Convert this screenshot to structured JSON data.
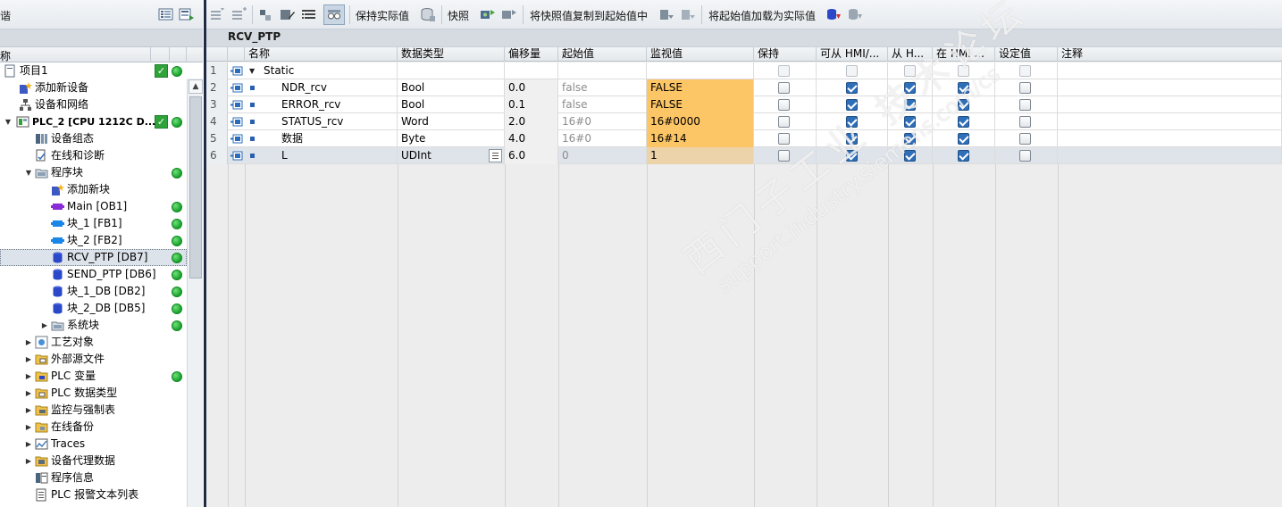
{
  "left_panel": {
    "toolbar_truncated_label": "谐",
    "column_header": "称",
    "tree": [
      {
        "label": "项目1",
        "indent": 0,
        "expand": "",
        "icon": "project-icon",
        "ok": true,
        "dot": true
      },
      {
        "label": "添加新设备",
        "indent": 1,
        "expand": "",
        "icon": "add-device-icon",
        "ok": false,
        "dot": false
      },
      {
        "label": "设备和网络",
        "indent": 1,
        "expand": "",
        "icon": "network-icon",
        "ok": false,
        "dot": false
      },
      {
        "label": "PLC_2 [CPU 1212C D...",
        "indent": 0,
        "expand": "down",
        "icon": "plc-icon",
        "ok": true,
        "dot": true,
        "bold": true
      },
      {
        "label": "设备组态",
        "indent": 2,
        "expand": "",
        "icon": "device-config-icon",
        "ok": false,
        "dot": false
      },
      {
        "label": "在线和诊断",
        "indent": 2,
        "expand": "",
        "icon": "online-diag-icon",
        "ok": false,
        "dot": false
      },
      {
        "label": "程序块",
        "indent": 2,
        "expand": "down",
        "icon": "folder-icon",
        "ok": false,
        "dot": true,
        "menu": "≡"
      },
      {
        "label": "添加新块",
        "indent": 3,
        "expand": "",
        "icon": "add-block-icon",
        "ok": false,
        "dot": false
      },
      {
        "label": "Main [OB1]",
        "indent": 3,
        "expand": "",
        "icon": "ob-icon",
        "ok": false,
        "dot": true
      },
      {
        "label": "块_1 [FB1]",
        "indent": 3,
        "expand": "",
        "icon": "fb-icon",
        "ok": false,
        "dot": true
      },
      {
        "label": "块_2 [FB2]",
        "indent": 3,
        "expand": "",
        "icon": "fb-icon",
        "ok": false,
        "dot": true
      },
      {
        "label": "RCV_PTP [DB7]",
        "indent": 3,
        "expand": "",
        "icon": "db-icon",
        "ok": false,
        "dot": true,
        "selected": true
      },
      {
        "label": "SEND_PTP [DB6]",
        "indent": 3,
        "expand": "",
        "icon": "db-icon",
        "ok": false,
        "dot": true
      },
      {
        "label": "块_1_DB [DB2]",
        "indent": 3,
        "expand": "",
        "icon": "db-icon",
        "ok": false,
        "dot": true
      },
      {
        "label": "块_2_DB [DB5]",
        "indent": 3,
        "expand": "",
        "icon": "db-icon",
        "ok": false,
        "dot": true
      },
      {
        "label": "系统块",
        "indent": 3,
        "expand": "right",
        "icon": "folder-icon",
        "ok": false,
        "dot": true
      },
      {
        "label": "工艺对象",
        "indent": 2,
        "expand": "right",
        "icon": "tech-object-icon",
        "ok": false,
        "dot": false
      },
      {
        "label": "外部源文件",
        "indent": 2,
        "expand": "right",
        "icon": "source-file-icon",
        "ok": false,
        "dot": false
      },
      {
        "label": "PLC 变量",
        "indent": 2,
        "expand": "right",
        "icon": "plc-tags-icon",
        "ok": false,
        "dot": true
      },
      {
        "label": "PLC 数据类型",
        "indent": 2,
        "expand": "right",
        "icon": "plc-datatype-icon",
        "ok": false,
        "dot": false
      },
      {
        "label": "监控与强制表",
        "indent": 2,
        "expand": "right",
        "icon": "watch-table-icon",
        "ok": false,
        "dot": false
      },
      {
        "label": "在线备份",
        "indent": 2,
        "expand": "right",
        "icon": "online-backup-icon",
        "ok": false,
        "dot": false
      },
      {
        "label": "Traces",
        "indent": 2,
        "expand": "right",
        "icon": "traces-icon",
        "ok": false,
        "dot": false
      },
      {
        "label": "设备代理数据",
        "indent": 2,
        "expand": "right",
        "icon": "proxy-data-icon",
        "ok": false,
        "dot": false
      },
      {
        "label": "程序信息",
        "indent": 2,
        "expand": "",
        "icon": "program-info-icon",
        "ok": false,
        "dot": false
      },
      {
        "label": "PLC 报警文本列表",
        "indent": 2,
        "expand": "",
        "icon": "alarm-text-icon",
        "ok": false,
        "dot": false
      }
    ]
  },
  "toolbar": {
    "keep_actual_label": "保持实际值",
    "snapshot_label": "快照",
    "copy_snapshot_label": "将快照值复制到起始值中",
    "load_start_label": "将起始值加载为实际值"
  },
  "editor": {
    "title": "RCV_PTP",
    "columns": {
      "name": "名称",
      "datatype": "数据类型",
      "offset": "偏移量",
      "start": "起始值",
      "monitor": "监视值",
      "retain": "保持",
      "hmi_access": "可从 HMI/...",
      "hmi_write": "从 H...",
      "hmi_visible": "在 HMI ...",
      "setpoint": "设定值",
      "comment": "注释"
    },
    "rows": [
      {
        "num": "1",
        "name": "Static",
        "type": "",
        "offset": "",
        "start": "",
        "monitor": "",
        "retain": false,
        "hmi_access": false,
        "hmi_write": false,
        "hmi_visible": false,
        "setpoint": false,
        "header": true
      },
      {
        "num": "2",
        "name": "NDR_rcv",
        "type": "Bool",
        "offset": "0.0",
        "start": "false",
        "monitor": "FALSE",
        "retain": false,
        "hmi_access": true,
        "hmi_write": true,
        "hmi_visible": true,
        "setpoint": false
      },
      {
        "num": "3",
        "name": "ERROR_rcv",
        "type": "Bool",
        "offset": "0.1",
        "start": "false",
        "monitor": "FALSE",
        "retain": false,
        "hmi_access": true,
        "hmi_write": true,
        "hmi_visible": true,
        "setpoint": false
      },
      {
        "num": "4",
        "name": "STATUS_rcv",
        "type": "Word",
        "offset": "2.0",
        "start": "16#0",
        "monitor": "16#0000",
        "retain": false,
        "hmi_access": true,
        "hmi_write": true,
        "hmi_visible": true,
        "setpoint": false
      },
      {
        "num": "5",
        "name": "数据",
        "type": "Byte",
        "offset": "4.0",
        "start": "16#0",
        "monitor": "16#14",
        "retain": false,
        "hmi_access": true,
        "hmi_write": true,
        "hmi_visible": true,
        "setpoint": false
      },
      {
        "num": "6",
        "name": "L",
        "type": "UDInt",
        "offset": "6.0",
        "start": "0",
        "monitor": "1",
        "retain": false,
        "hmi_access": true,
        "hmi_write": true,
        "hmi_visible": true,
        "setpoint": false,
        "selected": true
      }
    ]
  },
  "watermark": {
    "line1": "西门子工业 技术论坛",
    "line2": "support.industry.siemens.com/cs"
  },
  "colors": {
    "monitor_bg": "#fcc565",
    "checkbox_on": "#2f6fb8",
    "status_green": "#16a12a",
    "divider": "#1f2a44"
  }
}
